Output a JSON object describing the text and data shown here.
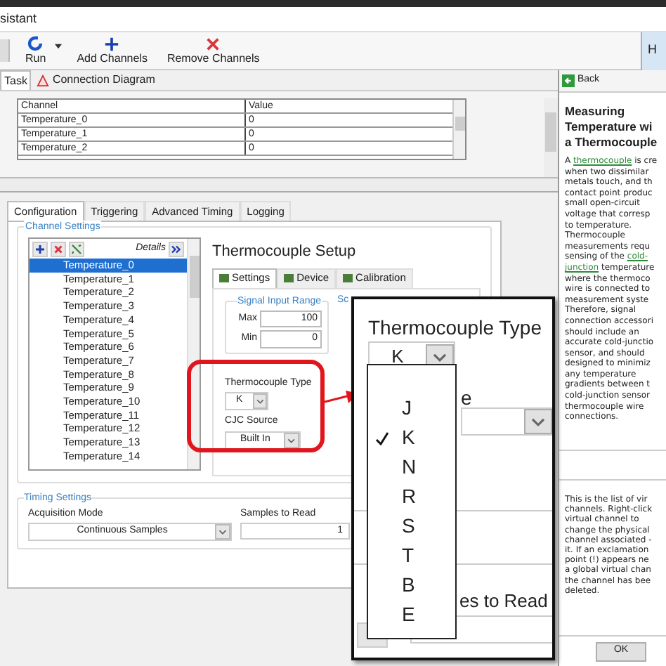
{
  "window": {
    "title": "sistant"
  },
  "toolbar": {
    "items": [
      {
        "label": "Run",
        "kind": "run"
      },
      {
        "label": "Add Channels",
        "kind": "add"
      },
      {
        "label": "Remove Channels",
        "kind": "remove"
      }
    ],
    "help_button": "H"
  },
  "task_tabs": [
    {
      "label": "Task",
      "selected": true
    },
    {
      "label": "Connection Diagram",
      "selected": false
    }
  ],
  "table": {
    "columns": [
      "Channel",
      "Value"
    ],
    "rows": [
      [
        "Temperature_0",
        "0"
      ],
      [
        "Temperature_1",
        "0"
      ],
      [
        "Temperature_2",
        "0"
      ]
    ]
  },
  "config_tabs": [
    {
      "label": "Configuration",
      "selected": true
    },
    {
      "label": "Triggering",
      "selected": false
    },
    {
      "label": "Advanced Timing",
      "selected": false
    },
    {
      "label": "Logging",
      "selected": false
    }
  ],
  "channel_settings": {
    "legend": "Channel Settings",
    "details": "Details",
    "channels": [
      {
        "name": "Temperature_0",
        "selected": true
      },
      {
        "name": "Temperature_1",
        "selected": false
      },
      {
        "name": "Temperature_2",
        "selected": false
      },
      {
        "name": "Temperature_3",
        "selected": false
      },
      {
        "name": "Temperature_4",
        "selected": false
      },
      {
        "name": "Temperature_5",
        "selected": false
      },
      {
        "name": "Temperature_6",
        "selected": false
      },
      {
        "name": "Temperature_7",
        "selected": false
      },
      {
        "name": "Temperature_8",
        "selected": false
      },
      {
        "name": "Temperature_9",
        "selected": false
      },
      {
        "name": "Temperature_10",
        "selected": false
      },
      {
        "name": "Temperature_11",
        "selected": false
      },
      {
        "name": "Temperature_12",
        "selected": false
      },
      {
        "name": "Temperature_13",
        "selected": false
      },
      {
        "name": "Temperature_14",
        "selected": false
      }
    ]
  },
  "setup": {
    "title": "Thermocouple Setup",
    "tabs": [
      {
        "label": "Settings",
        "selected": true
      },
      {
        "label": "Device",
        "selected": false
      },
      {
        "label": "Calibration",
        "selected": false
      }
    ],
    "range_legend": "Signal Input Range",
    "max_label": "Max",
    "max": "100",
    "min_label": "Min",
    "min": "0",
    "scaled_partial": "Sc",
    "tc_type_label": "Thermocouple Type",
    "tc_type": "K",
    "cjc_label": "CJC Source",
    "cjc": "Built In"
  },
  "timing": {
    "legend": "Timing Settings",
    "mode_label": "Acquisition Mode",
    "mode": "Continuous Samples",
    "samples_label": "Samples to Read",
    "samples": "1"
  },
  "zoom_inset": {
    "label": "Thermocouple Type",
    "value": "K",
    "partial_label": "e",
    "partial_samples": "es to Read",
    "options": [
      {
        "label": "J",
        "selected": false
      },
      {
        "label": "K",
        "selected": true
      },
      {
        "label": "N",
        "selected": false
      },
      {
        "label": "R",
        "selected": false
      },
      {
        "label": "S",
        "selected": false
      },
      {
        "label": "T",
        "selected": false
      },
      {
        "label": "B",
        "selected": false
      },
      {
        "label": "E",
        "selected": false
      }
    ]
  },
  "help": {
    "back": "Back",
    "title": "Measuring\nTemperature wi\na Thermocouple",
    "paragraph": [
      {
        "text": "A "
      },
      {
        "text": "thermocouple",
        "link": true
      },
      {
        "text": " is cre\nwhen two dissimilar\nmetals touch, and th\ncontact point produc\nsmall open-circuit\nvoltage that corresp\nto temperature.\nThermocouple\nmeasurements requ\nsensing of the "
      },
      {
        "text": "cold-",
        "link": true
      },
      {
        "text": "junction",
        "link": true,
        "line_start": true
      },
      {
        "text": " temperature\nwhere the thermoco\nwire is connected to\nmeasurement syste\nTherefore, signal\nconnection accessori\nshould include an\naccurate cold-junctio\nsensor, and should\ndesigned to minimiz\nany temperature\ngradients between t\ncold-junction sensor\nthermocouple wire\nconnections."
      }
    ],
    "note": "This is the list of vir\nchannels. Right-click\nvirtual channel to\nchange the physical\nchannel associated -\nit. If an exclamation\npoint (!) appears ne\na global virtual chan\nthe channel has bee\ndeleted.",
    "ok": "OK"
  }
}
